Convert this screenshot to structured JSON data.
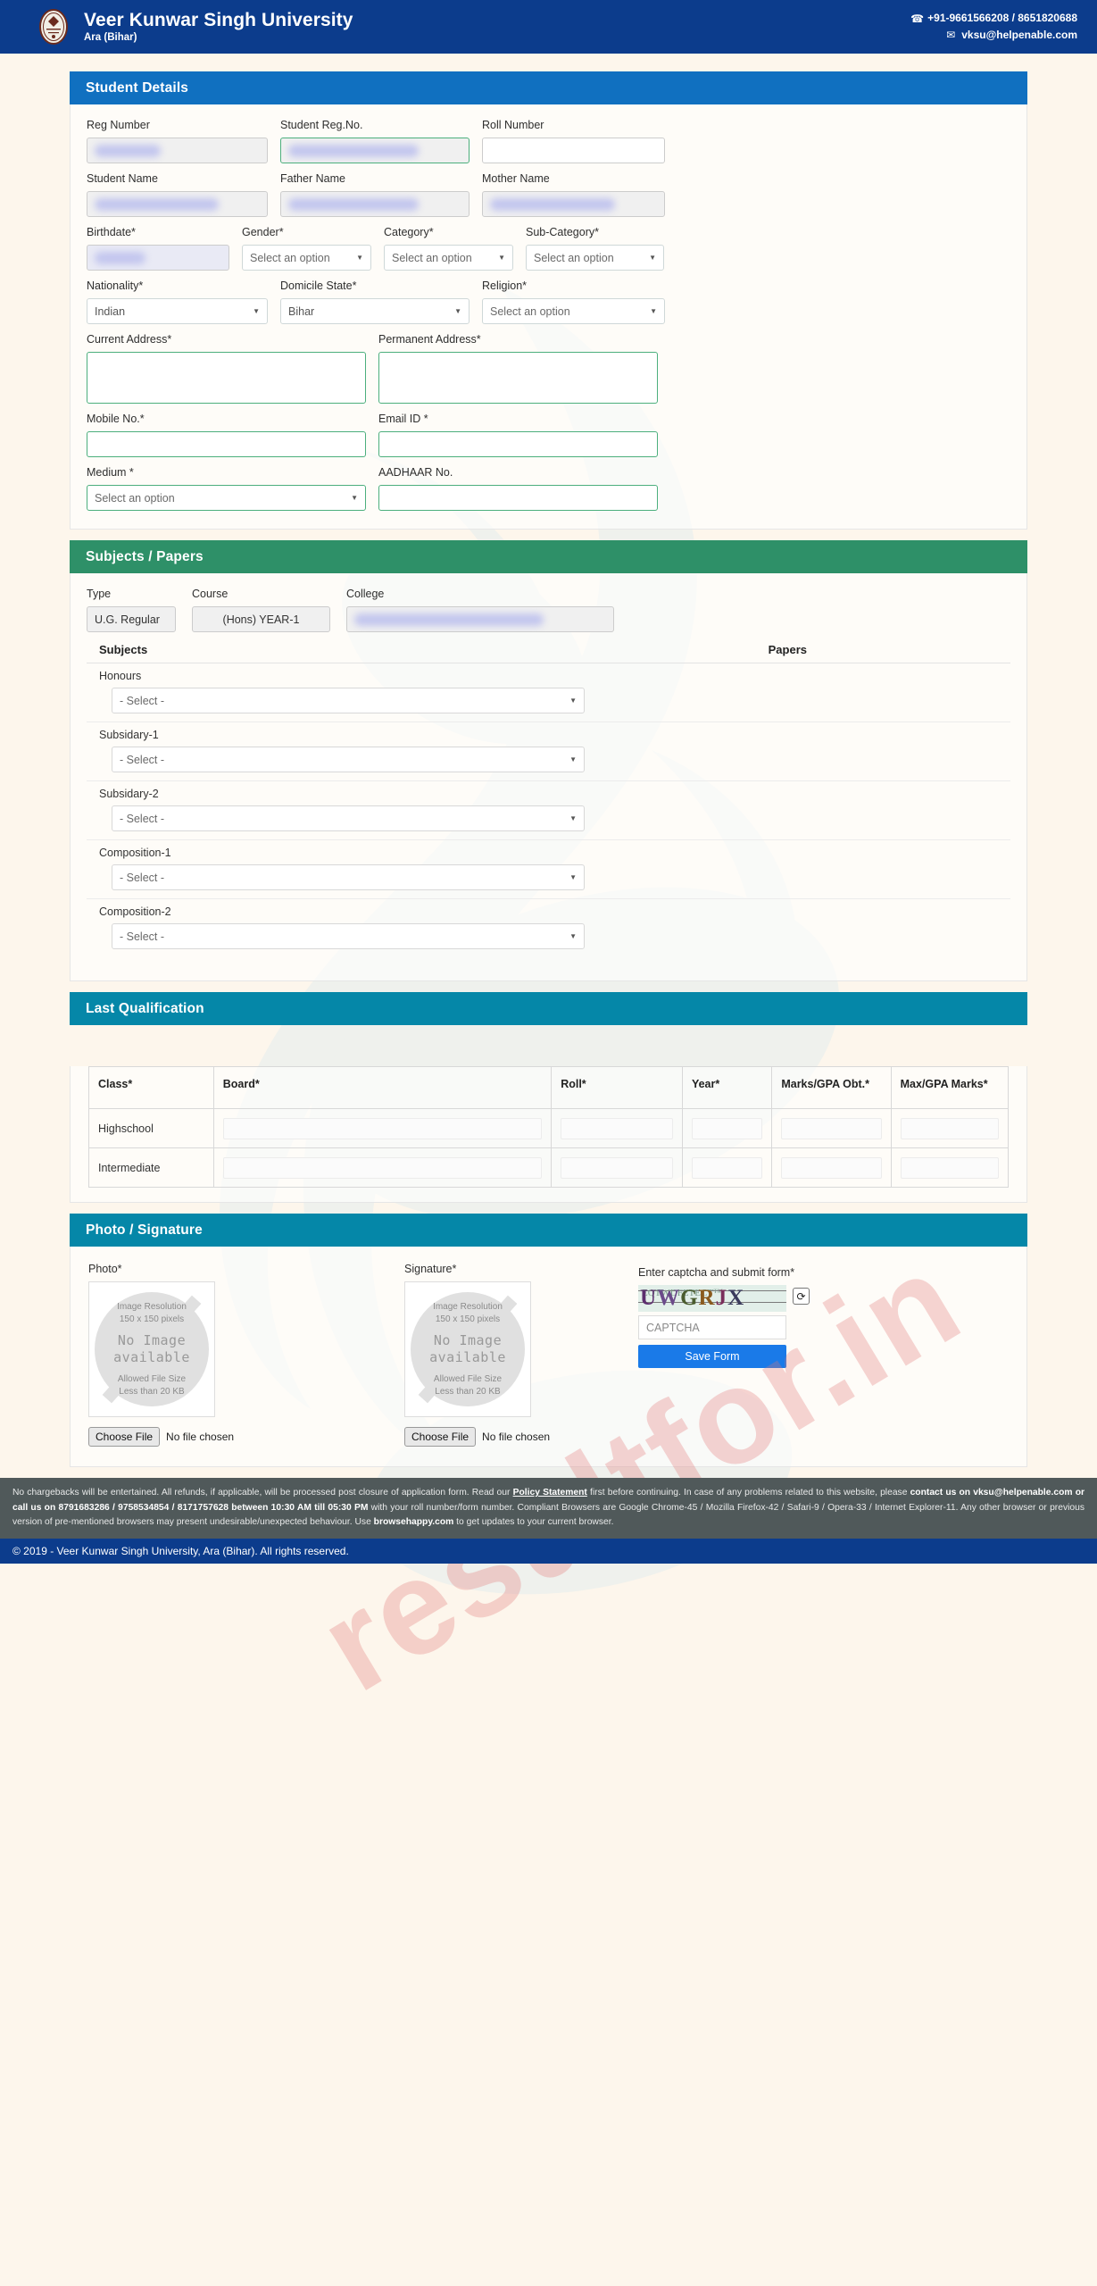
{
  "header": {
    "university": "Veer Kunwar Singh University",
    "location": "Ara (Bihar)",
    "phone": "+91-9661566208 / 8651820688",
    "email": "vksu@helpenable.com",
    "phone_icon": "phone-icon",
    "email_icon": "envelope-icon"
  },
  "watermark": {
    "text": "resultfor.in"
  },
  "student_details": {
    "title": "Student Details",
    "fields": {
      "reg_number_label": "Reg Number",
      "student_reg_no_label": "Student Reg.No.",
      "roll_number_label": "Roll Number",
      "student_name_label": "Student Name",
      "father_name_label": "Father Name",
      "mother_name_label": "Mother Name",
      "birthdate_label": "Birthdate*",
      "gender_label": "Gender*",
      "category_label": "Category*",
      "subcategory_label": "Sub-Category*",
      "nationality_label": "Nationality*",
      "domicile_label": "Domicile State*",
      "religion_label": "Religion*",
      "current_address_label": "Current Address*",
      "permanent_address_label": "Permanent Address*",
      "mobile_label": "Mobile No.*",
      "email_label": "Email ID *",
      "medium_label": "Medium *",
      "aadhaar_label": "AADHAAR No."
    },
    "values": {
      "gender": "Select an option",
      "category": "Select an option",
      "subcategory": "Select an option",
      "nationality": "Indian",
      "domicile": "Bihar",
      "religion": "Select an option",
      "medium": "Select an option"
    }
  },
  "subjects": {
    "title": "Subjects / Papers",
    "type_label": "Type",
    "course_label": "Course",
    "college_label": "College",
    "type_value": "U.G. Regular",
    "course_value": "(Hons) YEAR-1",
    "subjects_header": "Subjects",
    "papers_header": "Papers",
    "select_placeholder": "- Select -",
    "rows": [
      {
        "name": "Honours",
        "value": "- Select -"
      },
      {
        "name": "Subsidary-1",
        "value": "- Select -"
      },
      {
        "name": "Subsidary-2",
        "value": "- Select -"
      },
      {
        "name": "Composition-1",
        "value": "- Select -"
      },
      {
        "name": "Composition-2",
        "value": "- Select -"
      }
    ]
  },
  "last_qualification": {
    "title": "Last Qualification",
    "columns": [
      "Class*",
      "Board*",
      "Roll*",
      "Year*",
      "Marks/GPA Obt.*",
      "Max/GPA Marks*"
    ],
    "rows": [
      {
        "class": "Highschool"
      },
      {
        "class": "Intermediate"
      }
    ]
  },
  "photo_signature": {
    "title": "Photo / Signature",
    "photo_label": "Photo*",
    "signature_label": "Signature*",
    "placeholder": {
      "resolution_line1": "Image Resolution",
      "resolution_line2": "150 x 150 pixels",
      "noimage_line1": "No Image",
      "noimage_line2": "available",
      "filesize_line1": "Allowed File Size",
      "filesize_line2": "Less than 20 KB"
    },
    "choose_file": "Choose File",
    "no_file": "No file chosen",
    "captcha_label": "Enter captcha and submit form*",
    "captcha_text": "UWGRJX",
    "captcha_noise": "EQTWDFETECT™",
    "captcha_placeholder": "CAPTCHA",
    "refresh_icon": "refresh-icon",
    "save_button": "Save Form"
  },
  "footer": {
    "note_part1": "No chargebacks will be entertained. All refunds, if applicable, will be processed post closure of application form. Read our ",
    "note_link": "Policy Statement",
    "note_part2": " first before continuing. In case of any problems related to this website, please ",
    "note_bold1": "contact us on vksu@helpenable.com or call us on 8791683286 / 9758534854 / 8171757628 between 10:30 AM till 05:30 PM",
    "note_part3": " with your roll number/form number. Compliant Browsers are Google Chrome-45 / Mozilla Firefox-42 / Safari-9 / Opera-33 / Internet Explorer-11. Any other browser or previous version of pre-mentioned browsers may present undesirable/unexpected behaviour. Use ",
    "note_bold2": "browsehappy.com",
    "note_part4": " to get updates to your current browser.",
    "copyright": "© 2019 - Veer Kunwar Singh University, Ara (Bihar). All rights reserved."
  },
  "colors": {
    "header_blue": "#0c3c8c",
    "panel_blue": "#1070c0",
    "panel_green": "#2e9068",
    "panel_teal": "#0587a8",
    "save_blue": "#1a7ae8",
    "page_bg": "#fdf6ec"
  }
}
